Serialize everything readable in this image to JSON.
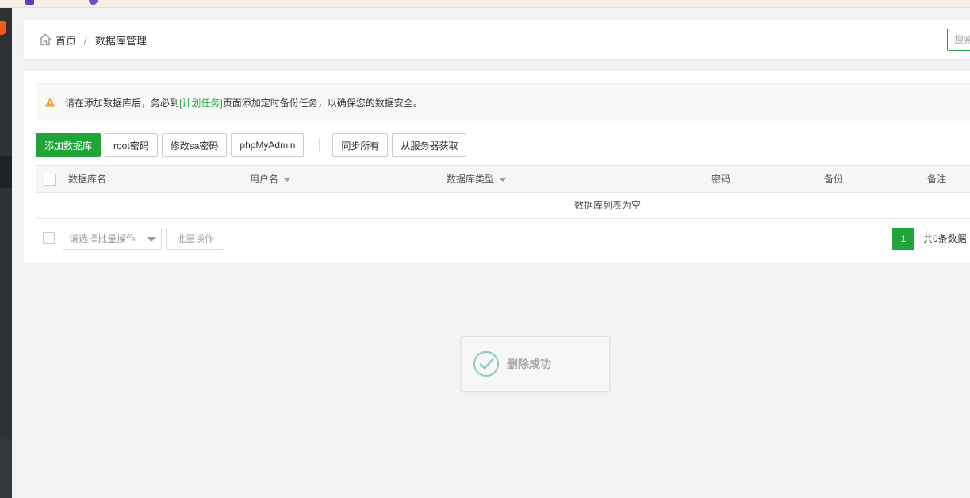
{
  "breadcrumb": {
    "home": "首页",
    "separator": "/",
    "current": "数据库管理"
  },
  "search": {
    "placeholder": "搜索"
  },
  "notice": {
    "prefix": "请在添加数据库后，务必到",
    "link": "[计划任务]",
    "suffix": "页面添加定时备份任务，以确保您的数据安全。"
  },
  "toolbar": {
    "add_db": "添加数据库",
    "root_pwd": "root密码",
    "sa_pwd": "修改sa密码",
    "phpmyadmin": "phpMyAdmin",
    "sync_all": "同步所有",
    "fetch_server": "从服务器获取"
  },
  "table": {
    "columns": [
      "数据库名",
      "用户名",
      "数据库类型",
      "密码",
      "备份",
      "备注"
    ],
    "empty_text": "数据库列表为空"
  },
  "footer": {
    "batch_placeholder": "请选择批量操作",
    "batch_button": "批量操作",
    "current_page": "1",
    "total_text": "共0条数据"
  },
  "toast": {
    "message": "删除成功"
  },
  "colors": {
    "accent": "#20a53a",
    "warning": "#f0a020",
    "sidebar": "#2d3237"
  }
}
